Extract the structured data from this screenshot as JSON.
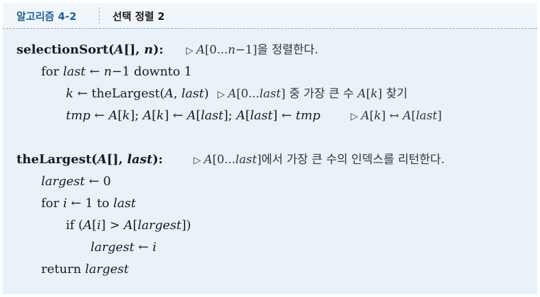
{
  "header": {
    "algorithm_id": "알고리즘 4-2",
    "title": "선택 정렬 2"
  },
  "code": {
    "f1_name": "selectionSort",
    "f1_open": "(",
    "f1_A": "A",
    "f1_mid": "[], ",
    "f1_n": "n",
    "f1_close": "):",
    "f1_comment_tri": "▷ ",
    "f1_comment_A": "A",
    "f1_comment_range": "[0...",
    "f1_comment_n": "n",
    "f1_comment_rest": "−1]을 정렬한다.",
    "l2_for": "for ",
    "l2_last": "last",
    "l2_arrow": " ← ",
    "l2_n": "n",
    "l2_rest": "−1 downto 1",
    "l3_k": "k",
    "l3_arrow": " ← ",
    "l3_call": "theLargest",
    "l3_open": "(",
    "l3_A": "A",
    "l3_comma": ", ",
    "l3_last": "last",
    "l3_close": ")",
    "l3_comment_tri": "▷ ",
    "l3_comment_A": "A",
    "l3_comment_range": "[0...",
    "l3_comment_last": "last",
    "l3_comment_mid": "] 중 가장 큰 수 ",
    "l3_comment_A2": "A",
    "l3_comment_b1": "[",
    "l3_comment_k": "k",
    "l3_comment_end": "] 찾기",
    "l4_tmp": "tmp",
    "l4_arrow1": " ← ",
    "l4_A1": "A",
    "l4_b1": "[",
    "l4_k1": "k",
    "l4_b2": "]; ",
    "l4_A2": "A",
    "l4_b3": "[",
    "l4_k2": "k",
    "l4_b4": "] ← ",
    "l4_A3": "A",
    "l4_b5": "[",
    "l4_last1": "last",
    "l4_b6": "]; ",
    "l4_A4": "A",
    "l4_b7": "[",
    "l4_last2": "last",
    "l4_b8": "] ← ",
    "l4_tmp2": "tmp",
    "l4_comment_tri": "▷ ",
    "l4_comment_A1": "A",
    "l4_comment_b1": "[",
    "l4_comment_k": "k",
    "l4_comment_swap": "] ↔ ",
    "l4_comment_A2": "A",
    "l4_comment_b2": "[",
    "l4_comment_last": "last",
    "l4_comment_b3": "]",
    "f2_name": "theLargest",
    "f2_open": "(",
    "f2_A": "A",
    "f2_mid": "[], ",
    "f2_last": "last",
    "f2_close": "):",
    "f2_comment_tri": "▷ ",
    "f2_comment_A": "A",
    "f2_comment_range": "[0...",
    "f2_comment_last": "last",
    "f2_comment_rest": "]에서 가장 큰 수의 인덱스를 리턴한다.",
    "l6_largest": "largest",
    "l6_rest": " ← 0",
    "l7_for": "for ",
    "l7_i": "i",
    "l7_mid": " ← 1 to ",
    "l7_last": "last",
    "l8_if": "if (",
    "l8_A1": "A",
    "l8_b1": "[",
    "l8_i": "i",
    "l8_gt": "] > ",
    "l8_A2": "A",
    "l8_b2": "[",
    "l8_largest": "largest",
    "l8_close": "])",
    "l9_largest": "largest",
    "l9_arrow": " ← ",
    "l9_i": "i",
    "l10_return": "return ",
    "l10_largest": "largest"
  }
}
